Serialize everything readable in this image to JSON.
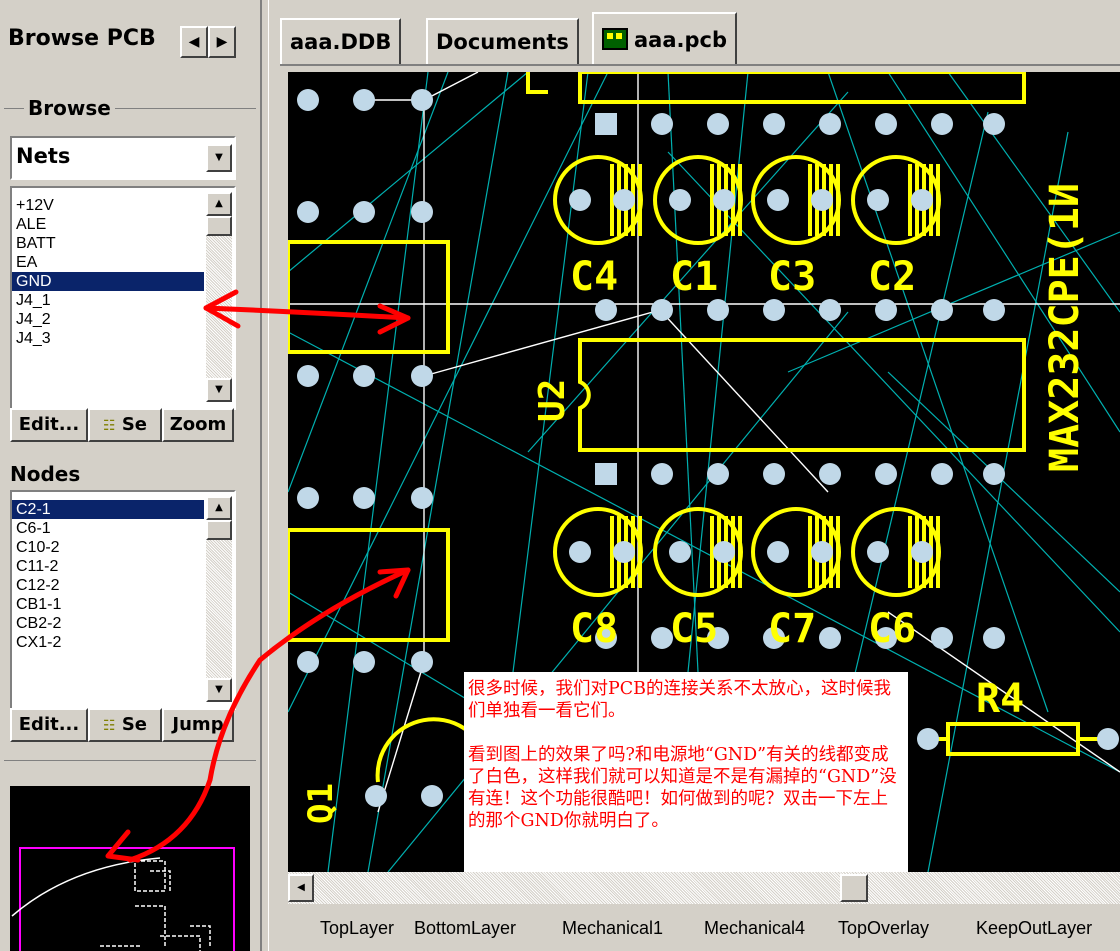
{
  "left_panel": {
    "header_title": "Browse PCB",
    "prev_symbol": "◀",
    "next_symbol": "▶",
    "browse_group_label": "Browse",
    "browse_combo_value": "Nets",
    "nets": [
      "+12V",
      "ALE",
      "BATT",
      "EA",
      "GND",
      "J4_1",
      "J4_2",
      "J4_3"
    ],
    "nets_selected": "GND",
    "nets_buttons": {
      "edit": "Edit...",
      "select": "Se",
      "zoom": "Zoom"
    },
    "nodes_label": "Nodes",
    "nodes": [
      "C2-1",
      "C6-1",
      "C10-2",
      "C11-2",
      "C12-2",
      "CB1-1",
      "CB2-2",
      "CX1-2"
    ],
    "nodes_selected": "C2-1",
    "nodes_buttons": {
      "edit": "Edit...",
      "select": "Se",
      "jump": "Jump"
    }
  },
  "tabs": [
    {
      "label": "aaa.DDB",
      "active": false
    },
    {
      "label": "Documents",
      "active": false
    },
    {
      "label": "aaa.pcb",
      "active": true
    }
  ],
  "pcb": {
    "components": {
      "caps_top": [
        "C4",
        "C1",
        "C3",
        "C2"
      ],
      "caps_bottom": [
        "C8",
        "C5",
        "C7",
        "C6"
      ],
      "ic_label": "U2",
      "ic2_label": "MAX232CPE(1И",
      "resistor": "R4",
      "transistor": "Q1"
    },
    "colors": {
      "background": "#000000",
      "silk": "#ffff00",
      "pad": "#c0d8e8",
      "ratsnest": "#00b0b0",
      "highlight_net": "#ffffff",
      "annotation_arrow": "#ff0000"
    }
  },
  "note": {
    "line1": "很多时候，我们对PCB的连接关系不太放心，这时候我们单独看一看它们。",
    "line2": "看到图上的效果了吗?和电源地“GND”有关的线都变成了白色，这样我们就可以知道是不是有漏掉的“GND”没有连！这个功能很酷吧！如何做到的呢？双击一下左上的那个GND你就明白了。"
  },
  "layer_tabs": [
    "TopLayer",
    "BottomLayer",
    "Mechanical1",
    "Mechanical4",
    "TopOverlay",
    "KeepOutLayer"
  ]
}
